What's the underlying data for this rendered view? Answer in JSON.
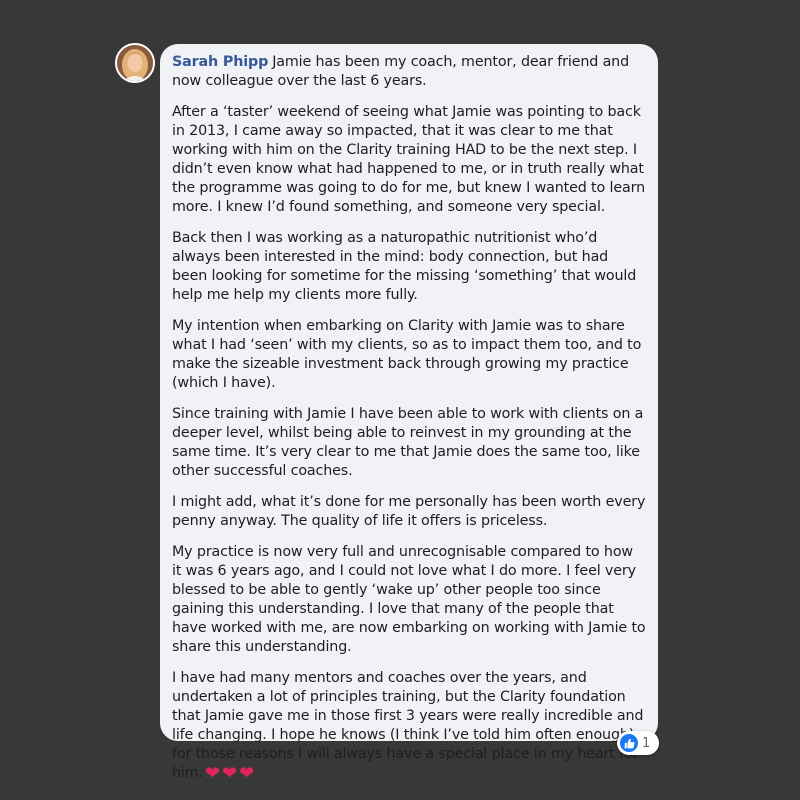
{
  "comment": {
    "author": "Sarah Phipp",
    "first_line": "Jamie has been my coach, mentor, dear friend and now colleague over the last 6 years.",
    "paragraphs": [
      "After a ‘taster’ weekend of seeing what Jamie was pointing to back in 2013, I came away so impacted, that it was clear to me that working with him on the Clarity training HAD to be the next step. I didn’t even know what had happened to me, or in truth really what the programme was going to do for me, but knew I wanted to learn more. I knew I’d found something, and someone very special.",
      "Back then I was working as a naturopathic nutritionist who’d always been interested in the mind: body connection, but had been looking for sometime for the missing ‘something’ that would help me help my clients more fully.",
      "My intention when embarking on Clarity with Jamie was to share what I had ‘seen’ with my clients, so as to impact them too, and to make the sizeable investment back through growing my practice (which I have).",
      "Since training with Jamie I have been able to work with clients on a deeper level, whilst being able to reinvest in my grounding at the same time. It’s very clear to me that Jamie does the same too, like other successful coaches.",
      "I might add, what it’s done for me personally has been worth every penny anyway. The quality of life it offers is priceless.",
      "My practice is now very full and unrecognisable compared to how it was 6 years ago, and I could not love what I do more. I feel very blessed to be able to gently ‘wake up’ other people too since gaining this understanding. I love that many of the people that have worked with me, are now embarking on working with Jamie to share this understanding."
    ],
    "last_paragraph": "I have had many mentors and coaches over the years, and undertaken a lot of principles training, but the Clarity foundation that Jamie gave me in those first 3 years were really incredible and life changing. I hope he knows (I think I’ve told him often enough) for those reasons I will always have a special place in my heart for him.",
    "hearts": "❤❤❤",
    "reaction": {
      "icon": "thumbs-up-icon",
      "count": "1"
    }
  },
  "colors": {
    "background": "#383838",
    "bubble": "#f0f2f5",
    "author_name": "#385898",
    "like_blue": "#1877f2",
    "heart_red": "#e0245e"
  }
}
